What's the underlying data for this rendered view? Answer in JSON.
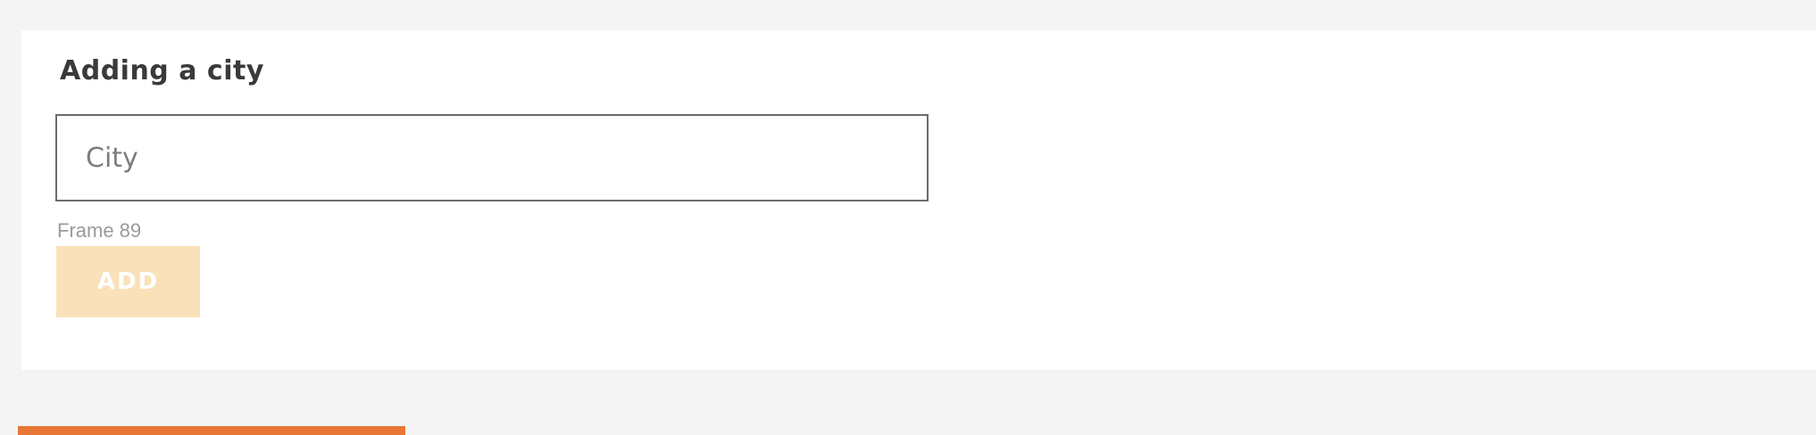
{
  "form": {
    "title": "Adding a city",
    "city_input": {
      "placeholder": "City",
      "value": ""
    },
    "frame_label": "Frame 89",
    "add_button_label": "ADD",
    "add_button_color": "#fae1b9",
    "add_button_state": "disabled"
  },
  "bottom_bar": {
    "color": "#e87737"
  }
}
